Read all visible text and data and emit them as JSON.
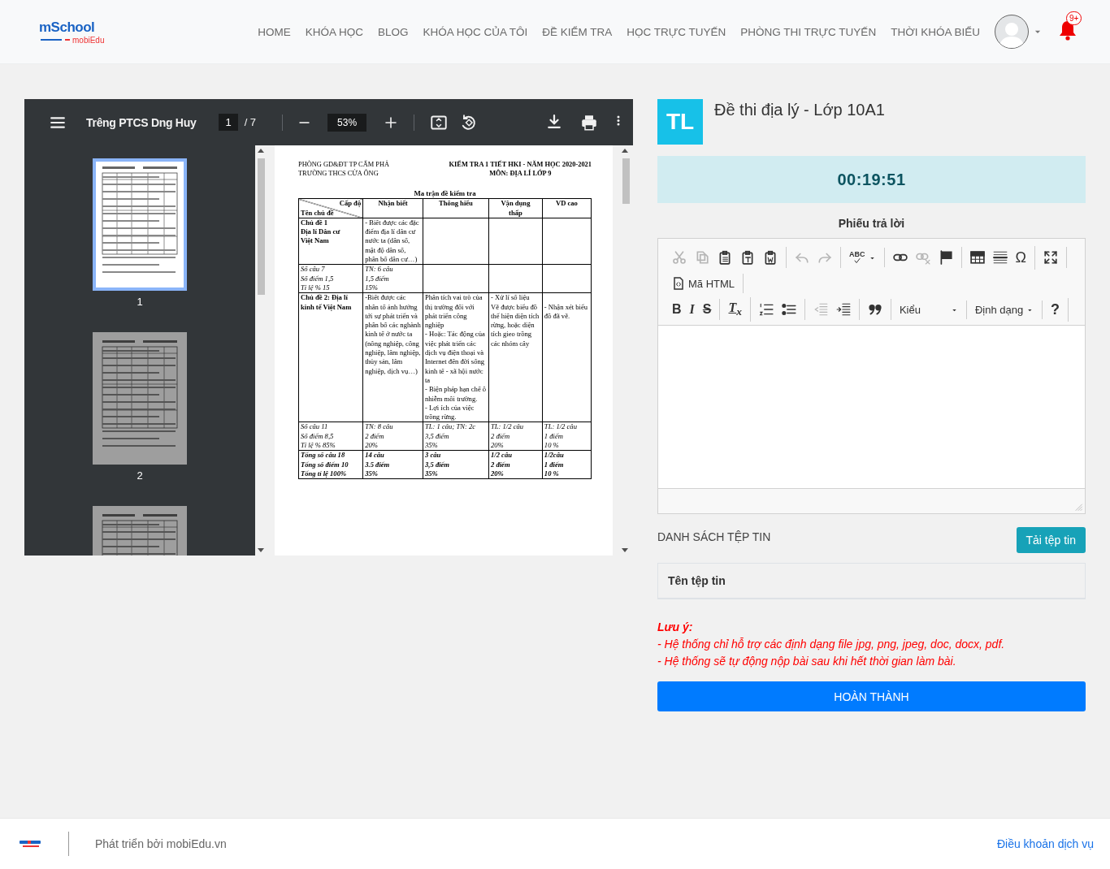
{
  "header": {
    "logo": {
      "name": "mSchool",
      "sub": "mobiEdu"
    },
    "nav": [
      "HOME",
      "KHÓA HỌC",
      "BLOG",
      "KHÓA HỌC CỦA TÔI",
      "ĐỀ KIỂM TRA",
      "HỌC TRỰC TUYẾN",
      "PHÒNG THI TRỰC TUYẾN",
      "THỜI KHÓA BIỂU"
    ],
    "notifications": "9+"
  },
  "viewer": {
    "title": "Trêng PTCS Dng Huy",
    "page": "1",
    "page_total": "/ 7",
    "zoom": "53%",
    "thumbnails": [
      {
        "label": "1",
        "selected": true
      },
      {
        "label": "2",
        "selected": false
      },
      {
        "selected": false
      }
    ],
    "document": {
      "header_left": [
        "PHÒNG GD&ĐT TP CẨM PHẢ",
        "TRƯỜNG THCS CỬA ÔNG"
      ],
      "header_right": [
        "KIỂM TRA 1 TIẾT HKI - NĂM HỌC 2020-2021",
        "MÔN: ĐỊA LÍ LỚP 9"
      ],
      "table_title": "Ma trận đề kiểm tra",
      "columns": [
        {
          "kind": "split",
          "top": "Cấp độ",
          "bottom": "Tên chủ đề"
        },
        {
          "kind": "plain",
          "label": "Nhận biết"
        },
        {
          "kind": "plain",
          "label": "Thông hiểu"
        },
        {
          "kind": "plain",
          "label": "Vận dụng\nthấp"
        },
        {
          "kind": "plain",
          "label": "VD cao"
        }
      ],
      "rows": [
        {
          "kind": "topic",
          "cells": [
            "Chủ đề 1\nĐịa lí Dân cư\nViệt Nam",
            "- Biết được các đặc điểm địa lí dân cư nước ta (dân số, mật độ dân số, phân bố dân cư…)",
            null,
            null,
            null
          ]
        },
        {
          "kind": "stats",
          "cells": [
            "Số câu 7\nSố điểm  1,5\nTỉ lệ %  15",
            "TN: 6 câu\n1,5 điểm\n15%",
            null,
            null,
            null
          ]
        },
        {
          "kind": "topic",
          "cells": [
            "Chủ đề 2: Địa lí kinh tế Việt Nam",
            "-Biết được các nhân tố ảnh hưởng tới sự phát triển và phân bố các nghành kinh tế ở nước ta (nông nghiệp, công nghiệp, lâm nghiệp, thủy sản, lâm nghiệp, dịch vụ…)",
            "Phân tích vai trò của thị trường đối với phát triển công nghiệp\n- Hoặc: Tác động của việc phát triển các dịch vụ điện thoại và Internet đến đời sống kinh tế - xã hội nước ta\n- Biện pháp hạn chế ô nhiễm môi trường.\n- Lợi ích của việc trồng rừng.",
            "- Xử lí số liệu\nVẽ được biểu đồ thể hiện diện tích rừng, hoặc diện tích gieo trồng các nhóm cây",
            "\n- Nhận xét biểu đồ đã vẽ."
          ]
        },
        {
          "kind": "stats",
          "cells": [
            "Số câu 11\nSố điểm 8,5\nTỉ lệ % 85%",
            "TN: 8 câu\n2  điểm\n20%",
            "TL: 1 câu; TN: 2c\n3,5  điểm\n35%",
            "TL: 1/2 câu\n2 điểm\n20%",
            "TL: 1/2 câu\n1 điểm\n10 %"
          ]
        },
        {
          "kind": "total",
          "cells": [
            "Tổng số câu 18\nTổng số điểm 10\nTổng tỉ lệ 100%",
            "14 câu\n3.5 điểm\n35%",
            "3  câu\n3,5 điểm\n35%",
            "1/2 câu\n2 điểm\n20%",
            "1/2câu\n1 điểm\n10 %"
          ]
        }
      ]
    }
  },
  "exam": {
    "avatar": "TL",
    "title": "Đề thi địa lý - Lớp 10A1",
    "timer": "00:19:51"
  },
  "answer": {
    "title": "Phiếu trả lời",
    "toolbar": [
      [
        [
          {
            "kind": "cut",
            "disabled": true
          },
          {
            "kind": "copy",
            "disabled": true
          },
          {
            "kind": "paste",
            "disabled": false
          },
          {
            "kind": "pastetext",
            "disabled": false
          },
          {
            "kind": "pasteword",
            "disabled": false
          }
        ],
        [
          {
            "kind": "undo",
            "disabled": true
          },
          {
            "kind": "redo",
            "disabled": true
          }
        ],
        [
          {
            "kind": "spell",
            "label": "ABC",
            "disabled": false
          }
        ],
        [
          {
            "kind": "link",
            "disabled": false
          },
          {
            "kind": "unlink",
            "disabled": true
          },
          {
            "kind": "anchor",
            "disabled": false
          }
        ],
        [
          {
            "kind": "table",
            "disabled": false
          },
          {
            "kind": "hr",
            "disabled": false
          },
          {
            "kind": "special",
            "label": "Ω",
            "disabled": false
          }
        ],
        [
          {
            "kind": "maximize",
            "disabled": false
          }
        ]
      ],
      [
        [
          {
            "kind": "source",
            "label": "Mã HTML",
            "disabled": false
          }
        ]
      ],
      [
        [
          {
            "kind": "bold",
            "label": "B",
            "disabled": false
          },
          {
            "kind": "italic",
            "label": "I",
            "disabled": false
          },
          {
            "kind": "strike",
            "label": "S",
            "disabled": false
          }
        ],
        [
          {
            "kind": "removeformat",
            "label": "T$_{x}$",
            "disabled": false
          }
        ],
        [
          {
            "kind": "numlist",
            "disabled": false
          },
          {
            "kind": "bulletlist",
            "disabled": false
          }
        ],
        [
          {
            "kind": "outdent",
            "disabled": true
          },
          {
            "kind": "indent",
            "disabled": false
          }
        ],
        [
          {
            "kind": "blockquote",
            "disabled": false
          }
        ],
        [
          {
            "kind": "dropdown",
            "label": "Kiểu",
            "disabled": false
          }
        ],
        [
          {
            "kind": "dropdown",
            "label": "Định dạng",
            "disabled": false
          }
        ],
        [
          {
            "kind": "help",
            "label": "?",
            "disabled": false
          }
        ]
      ]
    ]
  },
  "files": {
    "title": "DANH SÁCH TỆP TIN",
    "upload": "Tải tệp tin",
    "column": "Tên tệp tin"
  },
  "note": {
    "title": "Lưu ý:",
    "lines": [
      "- Hệ thống chỉ hỗ trợ các định dạng file jpg, png, jpeg, doc, docx, pdf.",
      "- Hệ thống sẽ tự động nộp bài sau khi hết thời gian làm bài."
    ]
  },
  "submit": "HOÀN THÀNH",
  "footer": {
    "credit": "Phát triển bởi mobiEdu.vn",
    "terms": "Điều khoản dịch vụ"
  }
}
